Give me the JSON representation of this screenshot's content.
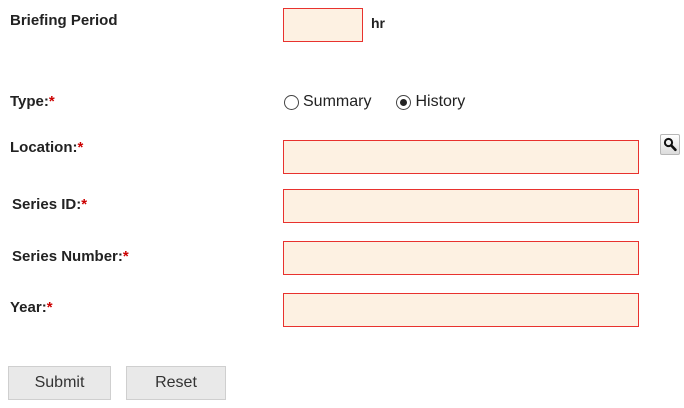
{
  "form": {
    "briefing_period": {
      "label": "Briefing Period",
      "value": "",
      "unit": "hr"
    },
    "type": {
      "label": "Type:",
      "required_marker": "*",
      "options": [
        {
          "label": "Summary",
          "selected": false
        },
        {
          "label": "History",
          "selected": true
        }
      ]
    },
    "location": {
      "label": "Location:",
      "required_marker": "*",
      "value": "",
      "lookup_icon": "search-icon"
    },
    "series_id": {
      "label": "Series ID:",
      "required_marker": "*",
      "value": ""
    },
    "series_number": {
      "label": "Series Number:",
      "required_marker": "*",
      "value": ""
    },
    "year": {
      "label": "Year:",
      "required_marker": "*",
      "value": ""
    }
  },
  "buttons": {
    "submit_label": "Submit",
    "reset_label": "Reset"
  },
  "colors": {
    "required": "#cc0000",
    "invalid_border": "#e8322e",
    "input_background": "#fdf1e2"
  }
}
